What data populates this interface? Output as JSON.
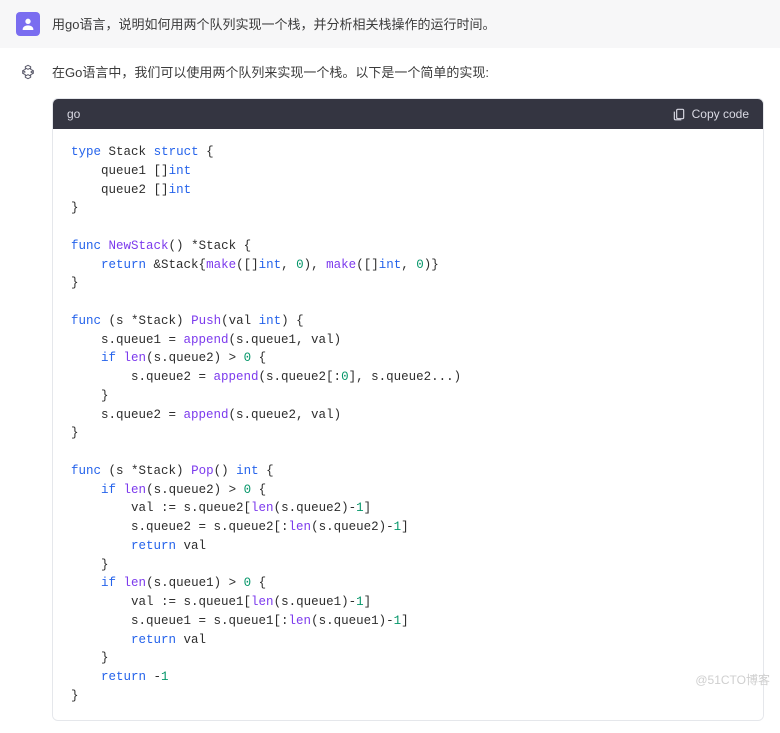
{
  "messages": {
    "user_text": "用go语言，说明如何用两个队列实现一个栈，并分析相关栈操作的运行时间。",
    "assistant_text": "在Go语言中，我们可以使用两个队列来实现一个栈。以下是一个简单的实现:",
    "lang_label": "go",
    "copy_label": "Copy code"
  },
  "code_tokens": {
    "struct_decl": {
      "kw_type": "type",
      "name": "Stack",
      "kw_struct": "struct"
    },
    "field1": {
      "name": "queue1",
      "type_open": "[]",
      "type": "int"
    },
    "field2": {
      "name": "queue2",
      "type_open": "[]",
      "type": "int"
    },
    "newstack": {
      "kw_func": "func",
      "name": "NewStack",
      "ret": "*Stack",
      "kw_return": "return",
      "amp": "&Stack{",
      "make": "make",
      "ty_a": "[]",
      "ty_int": "int",
      "zero": "0",
      "close": ")}"
    },
    "push": {
      "kw_func": "func",
      "recv": "(s *Stack)",
      "name": "Push",
      "param": "(val ",
      "ptype": "int",
      "pclose": ")",
      "l1": {
        "a": "s.queue1 = ",
        "fn": "append",
        "b": "(s.queue1, val)"
      },
      "l2": {
        "kw_if": "if",
        "fn_len": "len",
        "a": "(s.queue2) > ",
        "zero": "0"
      },
      "l3": {
        "a": "s.queue2 = ",
        "fn": "append",
        "b": "(s.queue2[:",
        "zero": "0",
        "c": "], s.queue2...)"
      },
      "l4": {
        "a": "s.queue2 = ",
        "fn": "append",
        "b": "(s.queue2, val)"
      }
    },
    "pop": {
      "kw_func": "func",
      "recv": "(s *Stack)",
      "name": "Pop",
      "ret": "int",
      "if1": {
        "kw_if": "if",
        "fn_len": "len",
        "a": "(s.queue2) > ",
        "zero": "0"
      },
      "v1a": {
        "a": "val := s.queue2[",
        "fn": "len",
        "b": "(s.queue2)-",
        "one": "1",
        "c": "]"
      },
      "v1b": {
        "a": "s.queue2 = s.queue2[:",
        "fn": "len",
        "b": "(s.queue2)-",
        "one": "1",
        "c": "]"
      },
      "r1": {
        "kw": "return",
        "v": " val"
      },
      "if2": {
        "kw_if": "if",
        "fn_len": "len",
        "a": "(s.queue1) > ",
        "zero": "0"
      },
      "v2a": {
        "a": "val := s.queue1[",
        "fn": "len",
        "b": "(s.queue1)-",
        "one": "1",
        "c": "]"
      },
      "v2b": {
        "a": "s.queue1 = s.queue1[:",
        "fn": "len",
        "b": "(s.queue1)-",
        "one": "1",
        "c": "]"
      },
      "r2": {
        "kw": "return",
        "v": " val"
      },
      "r3": {
        "kw": "return",
        "v": " -",
        "one": "1"
      }
    }
  },
  "watermark": "@51CTO博客"
}
